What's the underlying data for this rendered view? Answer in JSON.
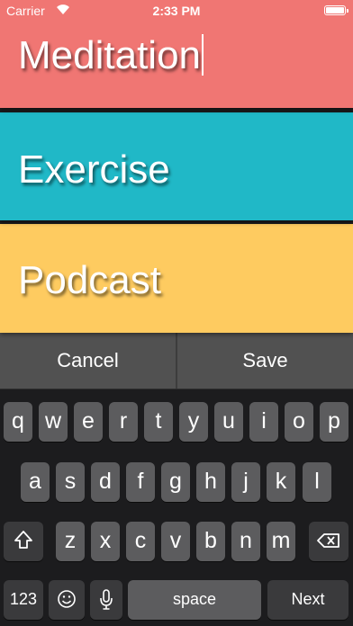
{
  "status_bar": {
    "carrier": "Carrier",
    "time": "2:33 PM"
  },
  "cards": [
    {
      "label": "Meditation",
      "color": "#f07673",
      "editing": true
    },
    {
      "label": "Exercise",
      "color": "#20b8c7"
    },
    {
      "label": "Podcast",
      "color": "#fecb60"
    }
  ],
  "actions": {
    "cancel": "Cancel",
    "save": "Save"
  },
  "keyboard": {
    "row1": [
      "q",
      "w",
      "e",
      "r",
      "t",
      "y",
      "u",
      "i",
      "o",
      "p"
    ],
    "row2": [
      "a",
      "s",
      "d",
      "f",
      "g",
      "h",
      "j",
      "k",
      "l"
    ],
    "row3": [
      "z",
      "x",
      "c",
      "v",
      "b",
      "n",
      "m"
    ],
    "numbers_label": "123",
    "space_label": "space",
    "next_label": "Next",
    "icons": [
      "shift-icon",
      "backspace-icon",
      "emoji-icon",
      "microphone-icon"
    ]
  }
}
